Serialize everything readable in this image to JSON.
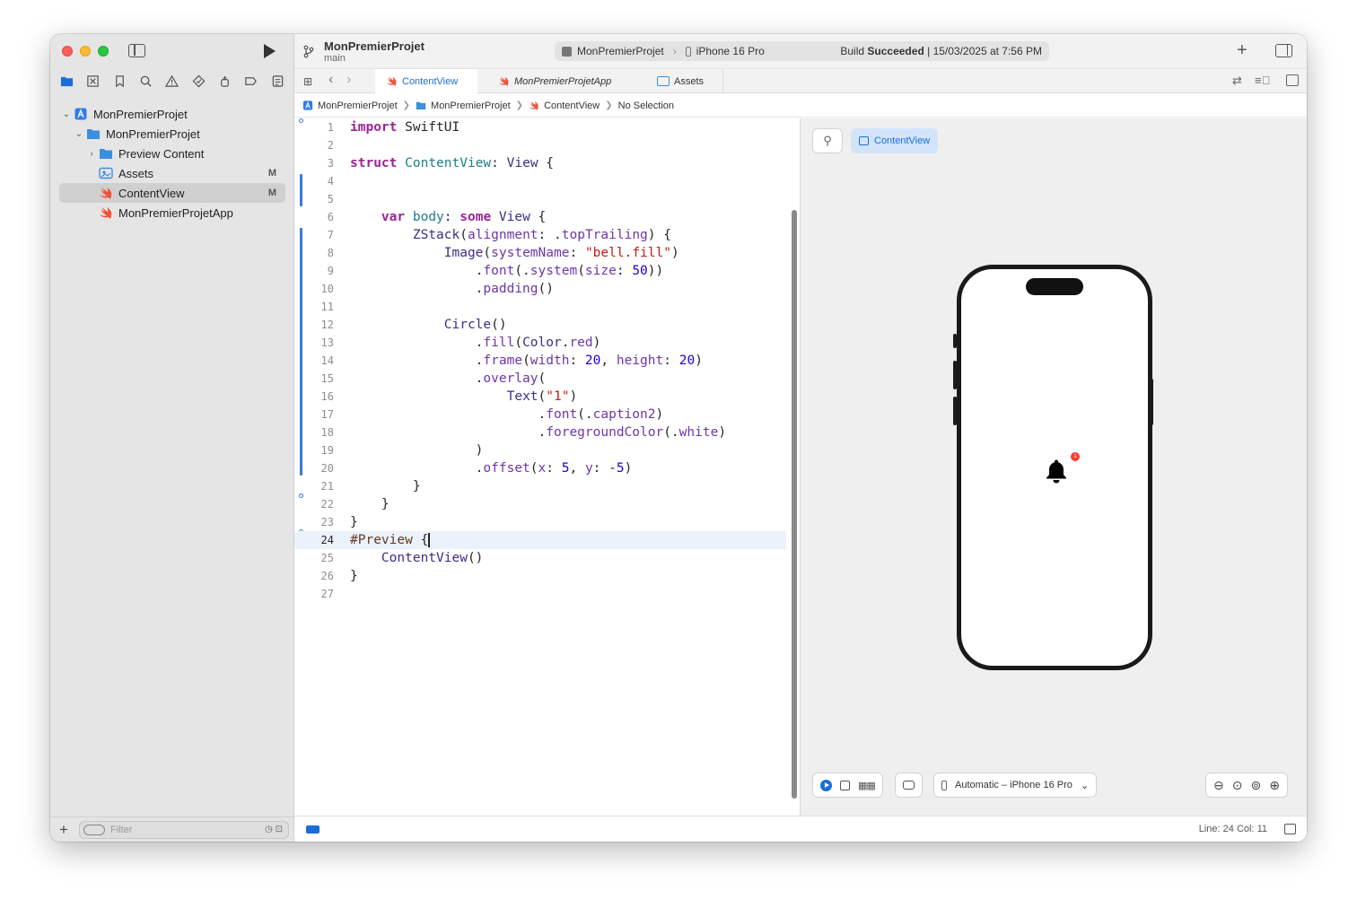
{
  "window": {
    "project_name": "MonPremierProjet",
    "branch": "main",
    "scheme": "MonPremierProjet",
    "device": "iPhone 16 Pro",
    "status_prefix": "Build ",
    "status_bold": "Succeeded",
    "status_suffix": " | 15/03/2025 at 7:56 PM"
  },
  "navigator": {
    "tree": [
      {
        "label": "MonPremierProjet",
        "badge": ""
      },
      {
        "label": "MonPremierProjet",
        "badge": ""
      },
      {
        "label": "Preview Content",
        "badge": ""
      },
      {
        "label": "Assets",
        "badge": "M"
      },
      {
        "label": "ContentView",
        "badge": "M"
      },
      {
        "label": "MonPremierProjetApp",
        "badge": ""
      }
    ],
    "filter_placeholder": "Filter"
  },
  "tabs": [
    {
      "label": "ContentView",
      "active": true
    },
    {
      "label": "MonPremierProjetApp",
      "active": false
    },
    {
      "label": "Assets",
      "active": false
    }
  ],
  "jumpbar": [
    "MonPremierProjet",
    "MonPremierProjet",
    "ContentView",
    "No Selection"
  ],
  "editor": {
    "current_line": 24,
    "line_numbers": [
      "1",
      "2",
      "3",
      "4",
      "5",
      "6",
      "7",
      "8",
      "9",
      "10",
      "11",
      "12",
      "13",
      "14",
      "15",
      "16",
      "17",
      "18",
      "19",
      "20",
      "21",
      "22",
      "23",
      "24",
      "25",
      "26",
      "27"
    ]
  },
  "canvas": {
    "preview_label": "ContentView",
    "notification_count": "1",
    "device_selector": "Automatic – iPhone 16 Pro"
  },
  "statusbar": {
    "line_col": "Line: 24  Col: 11"
  },
  "colors": {
    "accent": "#1a6ed8",
    "keyword": "#9b2393",
    "string": "#c41a16",
    "number": "#1c00cf",
    "badge_red": "#ff3b30"
  }
}
